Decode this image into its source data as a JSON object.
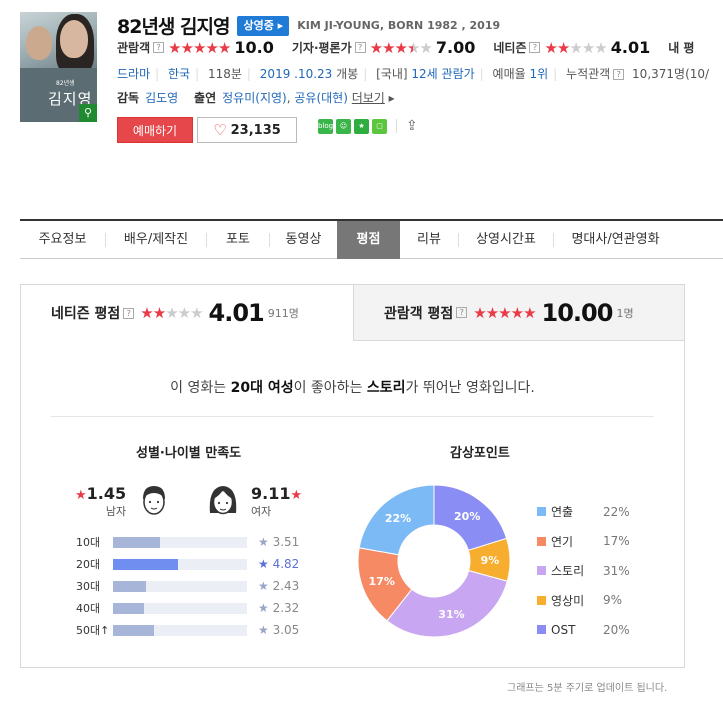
{
  "header": {
    "title": "82년생 김지영",
    "status_badge": "상영중",
    "english_title": "KIM JI-YOUNG, BORN 1982 , 2019",
    "poster": {
      "title": "김지영",
      "subtitle": "82년생"
    },
    "ratings": [
      {
        "label": "관람객",
        "score": "10.0",
        "stars": 5
      },
      {
        "label": "기자·평론가",
        "score": "7.00",
        "stars": 3.5
      },
      {
        "label": "네티즌",
        "score": "4.01",
        "stars": 2
      },
      {
        "label": "내 평"
      }
    ],
    "info": {
      "genre": "드라마",
      "country": "한국",
      "runtime": "118분",
      "release_date": "2019 .10.23",
      "release_suffix": "개봉",
      "grade_prefix": "[국내]",
      "grade": "12세 관람가",
      "booking_rank_label": "예매율",
      "booking_rank": "1위",
      "audience_label": "누적관객",
      "audience": "10,371명(10/"
    },
    "director_label": "감독",
    "director": "김도영",
    "cast_label": "출연",
    "cast": [
      "정유미(지영)",
      "공유(대현)"
    ],
    "cast_more": "더보기",
    "reserve_label": "예매하기",
    "like_count": "23,135",
    "share": {
      "blog": "blog"
    }
  },
  "tabs": [
    {
      "label": "주요정보",
      "active": false
    },
    {
      "label": "배우/제작진",
      "active": false
    },
    {
      "label": "포토",
      "active": false
    },
    {
      "label": "동영상",
      "active": false
    },
    {
      "label": "평점",
      "active": true
    },
    {
      "label": "리뷰",
      "active": false
    },
    {
      "label": "상영시간표",
      "active": false
    },
    {
      "label": "명대사/연관영화",
      "active": false
    }
  ],
  "panel": {
    "netizen": {
      "label": "네티즌 평점",
      "score": "4.01",
      "count": "911명",
      "stars": 2
    },
    "audience": {
      "label": "관람객 평점",
      "score": "10.00",
      "count": "1명",
      "stars": 5
    },
    "summary": {
      "pre": "이 영화는 ",
      "group": "20대 여성",
      "mid": "이 좋아하는 ",
      "point": "스토리",
      "post": "가 뛰어난 영화입니다."
    },
    "gender_title": "성별·나이별 만족도",
    "gender": [
      {
        "sex": "남자",
        "score": "1.45"
      },
      {
        "sex": "여자",
        "score": "9.11"
      }
    ],
    "ages": [
      {
        "label": "10대",
        "score": "3.51",
        "value": 3.51,
        "best": false
      },
      {
        "label": "20대",
        "score": "4.82",
        "value": 4.82,
        "best": true
      },
      {
        "label": "30대",
        "score": "2.43",
        "value": 2.43,
        "best": false
      },
      {
        "label": "40대",
        "score": "2.32",
        "value": 2.32,
        "best": false
      },
      {
        "label": "50대↑",
        "score": "3.05",
        "value": 3.05,
        "best": false
      }
    ],
    "point_title": "감상포인트",
    "footnote": "그래프는 5분 주기로 업데이트 됩니다."
  },
  "chart_data": {
    "type": "pie",
    "categories": [
      "연출",
      "연기",
      "스토리",
      "영상미",
      "OST"
    ],
    "values": [
      22,
      17,
      31,
      9,
      20
    ],
    "labels": [
      "22%",
      "17%",
      "31%",
      "9%",
      "20%"
    ],
    "colors": [
      "#7cbaf5",
      "#f58a64",
      "#c8a6f1",
      "#f7ad2e",
      "#8a8df3"
    ]
  },
  "colors": {
    "accent": "#e83a47",
    "link": "#1f67b8",
    "badge": "#1f7bd6"
  }
}
